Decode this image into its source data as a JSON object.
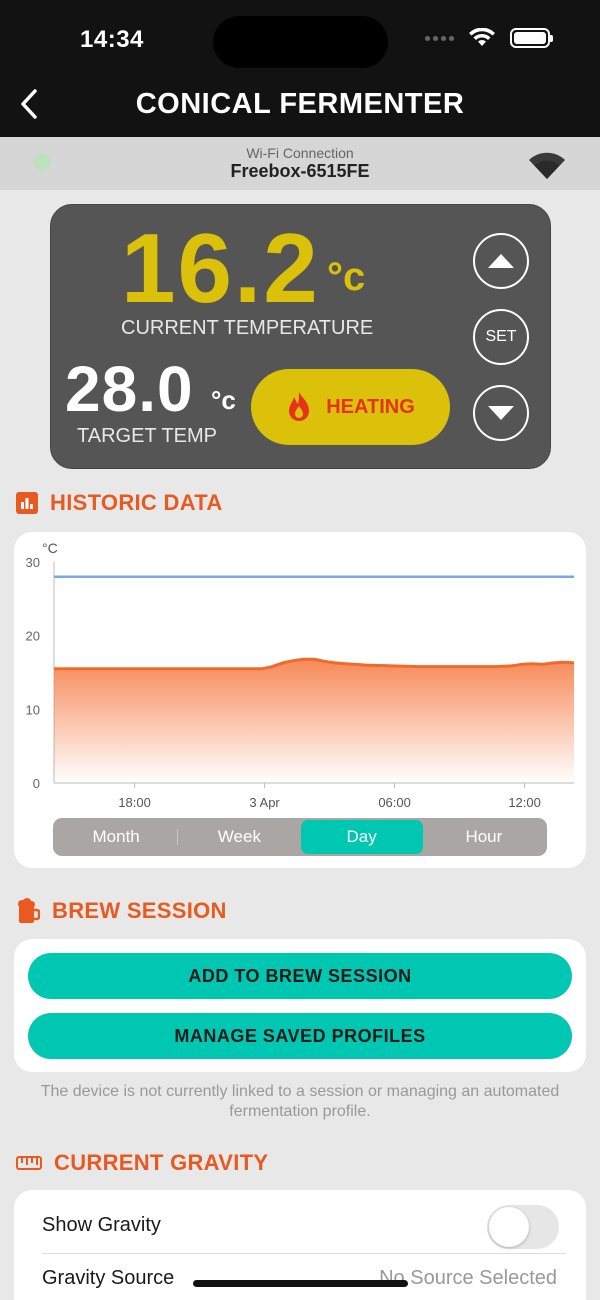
{
  "status_bar": {
    "time": "14:34"
  },
  "header": {
    "title": "CONICAL FERMENTER"
  },
  "wifi": {
    "label": "Wi-Fi Connection",
    "network": "Freebox-6515FE"
  },
  "temperature": {
    "current": "16.2",
    "current_unit": "°c",
    "current_label": "CURRENT TEMPERATURE",
    "target": "28.0",
    "target_unit": "°c",
    "target_label": "TARGET TEMP",
    "status": "HEATING",
    "set_label": "SET"
  },
  "historic": {
    "title": "HISTORIC DATA",
    "tabs": [
      "Month",
      "Week",
      "Day",
      "Hour"
    ],
    "active_tab": "Day"
  },
  "chart_data": {
    "type": "line",
    "ylabel": "°C",
    "ylim": [
      0,
      30
    ],
    "yticks": [
      0,
      10,
      20,
      30
    ],
    "x_tick_labels": [
      "18:00",
      "3 Apr",
      "06:00",
      "12:00"
    ],
    "grid": false,
    "series": [
      {
        "name": "",
        "color": "#7aa7e6",
        "x": [
          0,
          1
        ],
        "y": [
          28.0,
          28.0
        ]
      },
      {
        "name": "",
        "color": "#f06a2c",
        "fill": true,
        "x": [
          0,
          0.1,
          0.2,
          0.3,
          0.4,
          0.42,
          0.44,
          0.46,
          0.48,
          0.5,
          0.52,
          0.54,
          0.56,
          0.58,
          0.6,
          0.65,
          0.7,
          0.75,
          0.8,
          0.85,
          0.88,
          0.9,
          0.92,
          0.94,
          0.96,
          0.98,
          1.0
        ],
        "y": [
          15.5,
          15.5,
          15.5,
          15.5,
          15.5,
          15.8,
          16.3,
          16.6,
          16.8,
          16.8,
          16.5,
          16.3,
          16.2,
          16.1,
          16.0,
          15.9,
          15.8,
          15.8,
          15.8,
          15.8,
          15.9,
          16.1,
          16.2,
          16.1,
          16.3,
          16.4,
          16.3
        ]
      }
    ]
  },
  "brew": {
    "title": "BREW SESSION",
    "add_label": "ADD TO BREW SESSION",
    "manage_label": "MANAGE SAVED PROFILES",
    "note": "The device is not currently linked to a session or managing an automated fermentation profile."
  },
  "gravity": {
    "title": "CURRENT GRAVITY",
    "show_label": "Show Gravity",
    "show_enabled": false,
    "source_label": "Gravity Source",
    "source_value": "No Source Selected"
  },
  "colors": {
    "accent": "#e85a20",
    "teal": "#00c7b1",
    "yellow": "#dcc10a",
    "target_line": "#7aa7e6"
  }
}
